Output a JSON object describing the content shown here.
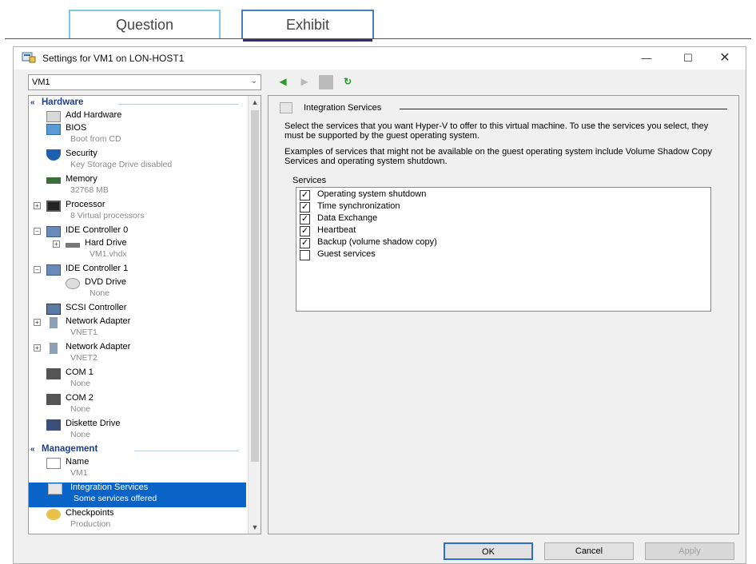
{
  "tabs": {
    "question": "Question",
    "exhibit": "Exhibit"
  },
  "window": {
    "title": "Settings for VM1 on LON-HOST1",
    "minimize": "—",
    "maximize": "☐",
    "close": "✕"
  },
  "vm_selector": {
    "value": "VM1",
    "dropdown_icon": "chevron-down-icon"
  },
  "nav": {
    "back_icon": "◀",
    "forward_icon": "▶",
    "refresh_icon": "↻"
  },
  "tree": {
    "hardware_header": "Hardware",
    "management_header": "Management",
    "items": {
      "add_hardware": {
        "label": "Add Hardware"
      },
      "bios": {
        "label": "BIOS",
        "sub": "Boot from CD"
      },
      "security": {
        "label": "Security",
        "sub": "Key Storage Drive disabled"
      },
      "memory": {
        "label": "Memory",
        "sub": "32768 MB"
      },
      "processor": {
        "label": "Processor",
        "sub": "8 Virtual processors"
      },
      "ide0": {
        "label": "IDE Controller 0"
      },
      "hdd": {
        "label": "Hard Drive",
        "sub": "VM1.vhdx"
      },
      "ide1": {
        "label": "IDE Controller 1"
      },
      "dvd": {
        "label": "DVD Drive",
        "sub": "None"
      },
      "scsi": {
        "label": "SCSI Controller"
      },
      "net1": {
        "label": "Network Adapter",
        "sub": "VNET1"
      },
      "net2": {
        "label": "Network Adapter",
        "sub": "VNET2"
      },
      "com1": {
        "label": "COM 1",
        "sub": "None"
      },
      "com2": {
        "label": "COM 2",
        "sub": "None"
      },
      "diskette": {
        "label": "Diskette Drive",
        "sub": "None"
      },
      "name": {
        "label": "Name",
        "sub": "VM1"
      },
      "integration": {
        "label": "Integration Services",
        "sub": "Some services offered"
      },
      "checkpoints": {
        "label": "Checkpoints",
        "sub": "Production"
      }
    }
  },
  "panel": {
    "heading": "Integration Services",
    "desc1": "Select the services that you want Hyper-V to offer to this virtual machine. To use the services you select, they must be supported by the guest operating system.",
    "desc2": "Examples of services that might not be available on the guest operating system include Volume Shadow Copy Services and operating system shutdown.",
    "group_label": "Services",
    "services": [
      {
        "label": "Operating system shutdown",
        "checked": true
      },
      {
        "label": "Time synchronization",
        "checked": true
      },
      {
        "label": "Data Exchange",
        "checked": true
      },
      {
        "label": "Heartbeat",
        "checked": true
      },
      {
        "label": "Backup (volume shadow copy)",
        "checked": true
      },
      {
        "label": "Guest services",
        "checked": false
      }
    ]
  },
  "buttons": {
    "ok": "OK",
    "cancel": "Cancel",
    "apply": "Apply"
  },
  "colors": {
    "selection": "#0a64c8",
    "section_header": "#1a3d8f",
    "ok_border": "#2a6fd0"
  }
}
